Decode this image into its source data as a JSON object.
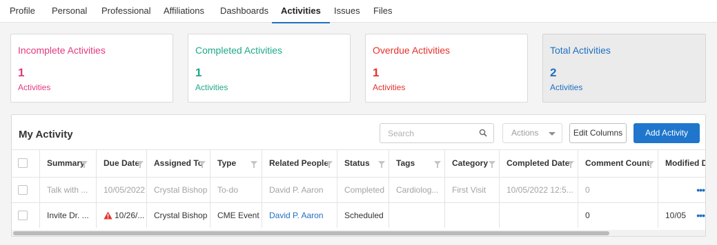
{
  "tabs": [
    "Profile",
    "Personal",
    "Professional",
    "Affiliations",
    "Dashboards",
    "Activities",
    "Issues",
    "Files"
  ],
  "active_tab": "Activities",
  "cards": [
    {
      "title": "Incomplete Activities",
      "count": "1",
      "unit": "Activities",
      "color": "#e4387f"
    },
    {
      "title": "Completed Activities",
      "count": "1",
      "unit": "Activities",
      "color": "#1fa888"
    },
    {
      "title": "Overdue Activities",
      "count": "1",
      "unit": "Activities",
      "color": "#e5302b"
    },
    {
      "title": "Total Activities",
      "count": "2",
      "unit": "Activities",
      "color": "#1f6fc1"
    }
  ],
  "panel": {
    "title": "My Activity",
    "search_placeholder": "Search",
    "actions_label": "Actions",
    "edit_columns_label": "Edit Columns",
    "add_activity_label": "Add Activity"
  },
  "table": {
    "columns": [
      "Summary",
      "Due Date",
      "Assigned To",
      "Type",
      "Related People",
      "Status",
      "Tags",
      "Category",
      "Completed Date",
      "Comment Count",
      "Modified Date"
    ],
    "rows": [
      {
        "summary": "Talk with ...",
        "due_date": "10/05/2022",
        "assigned_to": "Crystal Bishop",
        "type": "To-do",
        "related_people": "David P. Aaron",
        "status": "Completed",
        "tags": "Cardiolog...",
        "category": "First Visit",
        "completed_date": "10/05/2022 12:5...",
        "comment_count": "0",
        "modified_date": "",
        "overdue": false,
        "muted": true
      },
      {
        "summary": "Invite Dr. ...",
        "due_date": "10/26/...",
        "assigned_to": "Crystal Bishop",
        "type": "CME Event",
        "related_people": "David P. Aaron",
        "status": "Scheduled",
        "tags": "",
        "category": "",
        "completed_date": "",
        "comment_count": "0",
        "modified_date": "10/05",
        "overdue": true,
        "muted": false
      }
    ]
  },
  "icons": {
    "search": "search-icon",
    "filter": "filter-icon",
    "warning": "warning-icon",
    "more": "more-options-icon"
  }
}
